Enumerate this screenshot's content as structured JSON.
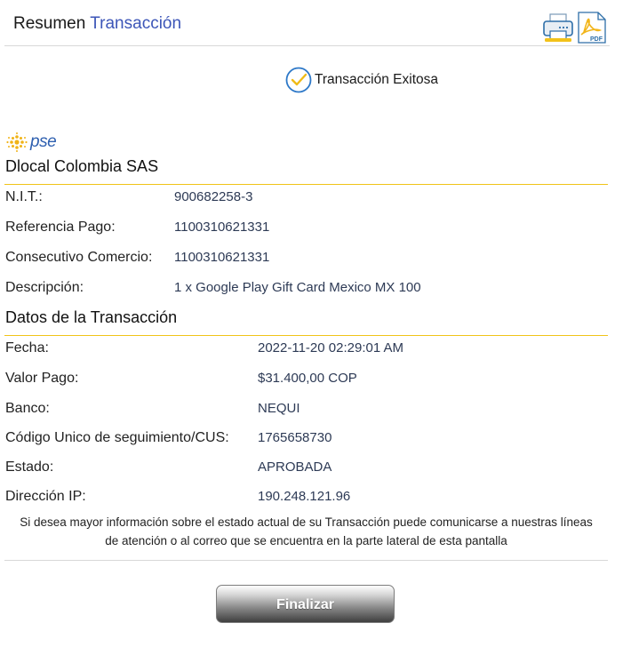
{
  "header": {
    "title_part1": "Resumen",
    "title_part2": "Transacción",
    "print_icon": "printer-icon",
    "pdf_icon": "pdf-icon",
    "pdf_label": "PDF"
  },
  "status": {
    "text": "Transacción Exitosa",
    "icon": "check-circle-icon"
  },
  "pse": {
    "logo_text": "pse"
  },
  "merchant": {
    "name": "Dlocal Colombia SAS",
    "rows": [
      {
        "label": "N.I.T.:",
        "value": "900682258-3"
      },
      {
        "label": "Referencia Pago:",
        "value": "1100310621331"
      },
      {
        "label": "Consecutivo Comercio:",
        "value": "1100310621331"
      },
      {
        "label": "Descripción:",
        "value": "1 x Google Play Gift Card Mexico MX 100"
      }
    ]
  },
  "transaction": {
    "heading": "Datos de la Transacción",
    "rows": [
      {
        "label": "Fecha:",
        "value": "2022-11-20 02:29:01 AM"
      },
      {
        "label": "Valor Pago:",
        "value": "$31.400,00 COP"
      },
      {
        "label": "Banco:",
        "value": "NEQUI"
      },
      {
        "label": "Código Unico de seguimiento/CUS:",
        "value": "1765658730"
      },
      {
        "label": "Estado:",
        "value": "APROBADA"
      },
      {
        "label": "Dirección IP:",
        "value": "190.248.121.96"
      }
    ]
  },
  "note": {
    "line1": "Si desea mayor información sobre el estado actual de su Transacción puede comunicarse a nuestras líneas",
    "line2": "de atención o al correo que se encuentra en la parte lateral de esta pantalla"
  },
  "button": {
    "label": "Finalizar"
  },
  "colors": {
    "accent_blue": "#3d56b8",
    "gold_line": "#f0c419",
    "value_text": "#2d3a55"
  }
}
